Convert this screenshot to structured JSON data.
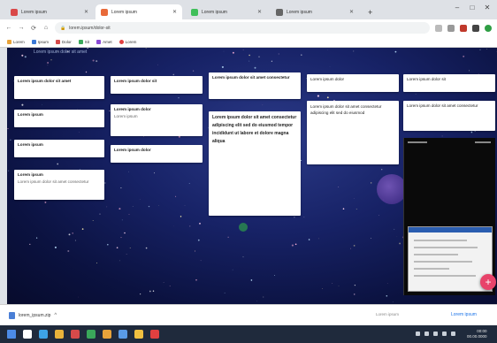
{
  "browser": {
    "tabs": [
      {
        "label": "Lorem ipsum",
        "favicon_color": "#d94848",
        "active": false
      },
      {
        "label": "Lorem ipsum",
        "favicon_color": "#e86a3a",
        "active": true
      },
      {
        "label": "Lorem ipsum",
        "favicon_color": "#3fbf5a",
        "active": false
      },
      {
        "label": "Lorem ipsum",
        "favicon_color": "#666666",
        "active": false
      }
    ],
    "new_tab_glyph": "+",
    "window_buttons": [
      "–",
      "□",
      "✕"
    ],
    "url": "lorem.ipsum/dolor-sit",
    "nav_glyphs": [
      "←",
      "→",
      "⟳",
      "⌂"
    ],
    "bookmarks": [
      {
        "label": "Lorem",
        "color": "#e8a33a"
      },
      {
        "label": "Ipsum",
        "color": "#3a78d6"
      },
      {
        "label": "Dolor",
        "color": "#d64a4a"
      },
      {
        "label": "Sit",
        "color": "#3aa85a"
      },
      {
        "label": "Amet",
        "color": "#8a4ad6"
      },
      {
        "label": "Lorem",
        "color": "#e04040"
      }
    ]
  },
  "board": {
    "header": "Lorem ipsum dolor sit amet",
    "posts": [
      {
        "title": "Lorem ipsum dolor sit amet",
        "subtitle": ""
      },
      {
        "title": "Lorem ipsum",
        "subtitle": ""
      },
      {
        "title": "Lorem ipsum",
        "subtitle": ""
      },
      {
        "title": "Lorem ipsum",
        "subtitle": "Lorem ipsum dolor sit amet consectetur"
      },
      {
        "title": "Lorem ipsum dolor sit",
        "subtitle": ""
      },
      {
        "title": "Lorem ipsum dolor",
        "subtitle": "Lorem ipsum"
      },
      {
        "title": "Lorem ipsum dolor",
        "subtitle": ""
      },
      {
        "title": "Lorem ipsum dolor sit amet consectetur",
        "subtitle": ""
      },
      {
        "title": "Lorem ipsum dolor sit amet consectetur adipiscing elit sed do eiusmod tempor incididunt ut labore et dolore magna aliqua",
        "subtitle": ""
      },
      {
        "title": "Lorem ipsum dolor",
        "subtitle": ""
      },
      {
        "title": "Lorem ipsum dolor sit amet consectetur adipiscing elit sed do eiusmod",
        "subtitle": ""
      },
      {
        "title": "Lorem ipsum dolor sit",
        "subtitle": ""
      },
      {
        "title": "Lorem ipsum dolor sit amet consectetur",
        "subtitle": ""
      }
    ],
    "fab_glyph": "+"
  },
  "downloads": {
    "file": "lorem_ipsum.zip",
    "caret": "^",
    "note": "Lorem ipsum",
    "show_all": "Lorem ipsum"
  },
  "taskbar": {
    "time": "00:00",
    "date": "00.00.0000",
    "app_colors": [
      "#4c8be6",
      "#ffffff",
      "#3da3e6",
      "#e8b33a",
      "#d64a4a",
      "#3aa85a",
      "#e8a33a",
      "#5a9be6",
      "#f0c040",
      "#e04040"
    ]
  }
}
